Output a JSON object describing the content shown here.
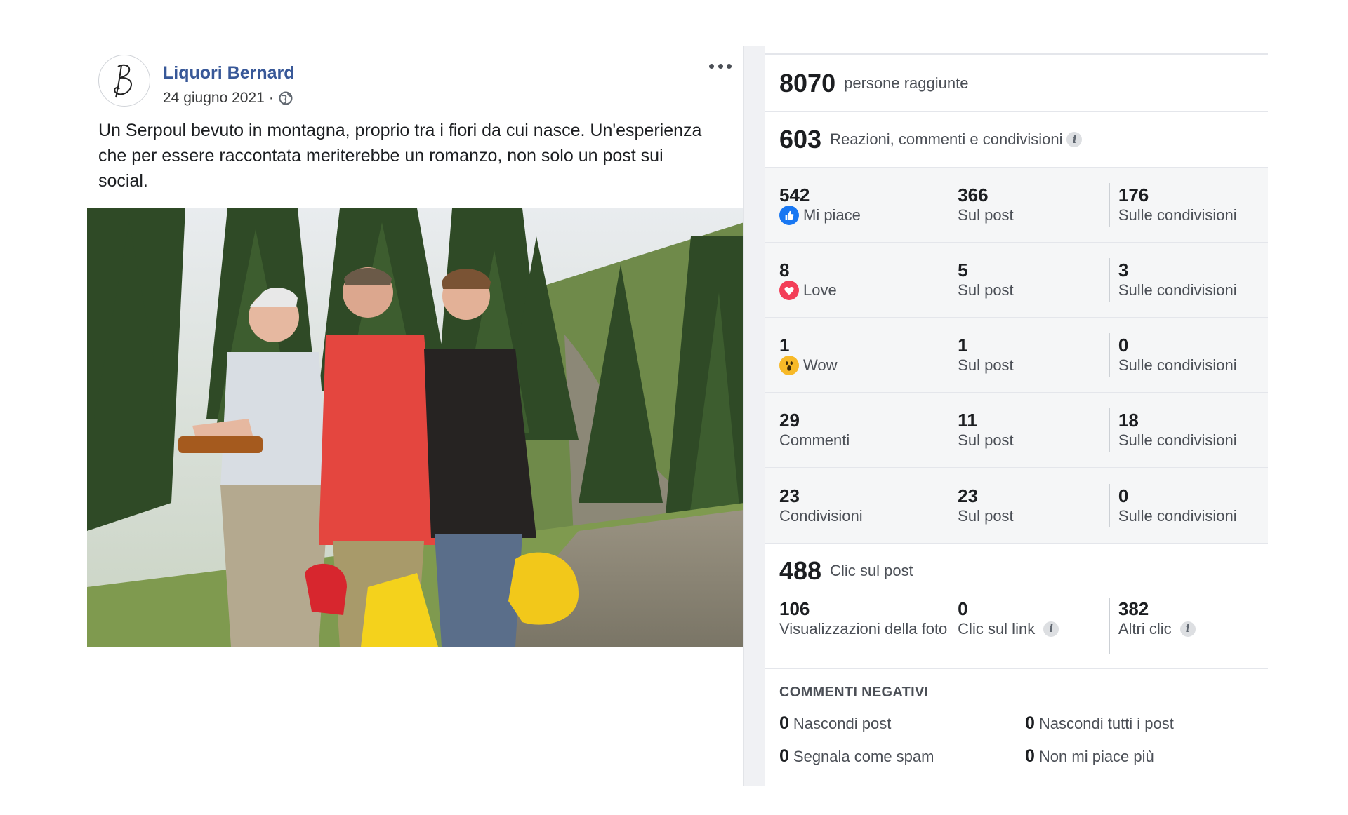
{
  "post": {
    "page_name": "Liquori Bernard",
    "date": "24 giugno 2021",
    "separator": "·",
    "text": "Un Serpoul bevuto in montagna, proprio tra i fiori da cui nasce. Un'esperienza che per essere raccontata meriterebbe un romanzo, non solo un post sui social."
  },
  "insights": {
    "reach": {
      "value": "8070",
      "label": "persone raggiunte"
    },
    "engagement": {
      "value": "603",
      "label": "Reazioni, commenti e condivisioni"
    },
    "rows": [
      {
        "total": "542",
        "label": "Mi piace",
        "icon": "like-icon",
        "post": "366",
        "post_label": "Sul post",
        "shares": "176",
        "shares_label": "Sulle condivisioni"
      },
      {
        "total": "8",
        "label": "Love",
        "icon": "love-icon",
        "post": "5",
        "post_label": "Sul post",
        "shares": "3",
        "shares_label": "Sulle condivisioni"
      },
      {
        "total": "1",
        "label": "Wow",
        "icon": "wow-icon",
        "post": "1",
        "post_label": "Sul post",
        "shares": "0",
        "shares_label": "Sulle condivisioni"
      },
      {
        "total": "29",
        "label": "Commenti",
        "icon": "",
        "post": "11",
        "post_label": "Sul post",
        "shares": "18",
        "shares_label": "Sulle condivisioni"
      },
      {
        "total": "23",
        "label": "Condivisioni",
        "icon": "",
        "post": "23",
        "post_label": "Sul post",
        "shares": "0",
        "shares_label": "Sulle condivisioni"
      }
    ],
    "clicks": {
      "value": "488",
      "label": "Clic sul post",
      "photo_views": {
        "value": "106",
        "label": "Visualizzazioni della foto"
      },
      "link_clicks": {
        "value": "0",
        "label": "Clic sul link"
      },
      "other_clicks": {
        "value": "382",
        "label": "Altri clic"
      }
    },
    "negative": {
      "title": "COMMENTI NEGATIVI",
      "hide_post": {
        "value": "0",
        "label": "Nascondi post"
      },
      "hide_all": {
        "value": "0",
        "label": "Nascondi tutti i post"
      },
      "spam": {
        "value": "0",
        "label": "Segnala come spam"
      },
      "unlike": {
        "value": "0",
        "label": "Non mi piace più"
      }
    }
  },
  "colors": {
    "page_name": "#385898",
    "like": "#1877f2",
    "love": "#f33e58",
    "wow": "#f7b928"
  }
}
